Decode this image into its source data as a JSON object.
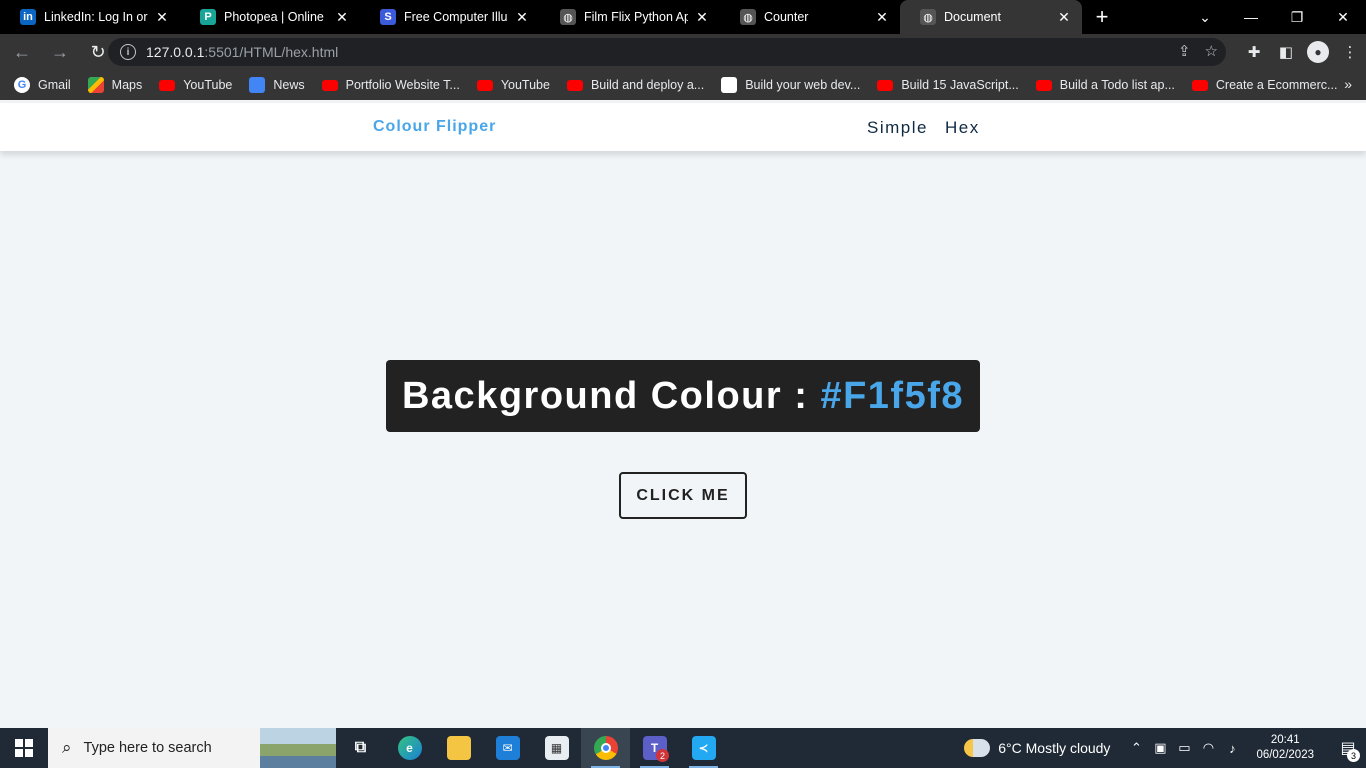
{
  "browser": {
    "tabs": [
      {
        "title": "LinkedIn: Log In or Sig",
        "icon": "linkedin-icon",
        "color": "#0a66c2",
        "glyph": "in"
      },
      {
        "title": "Photopea | Online Pho",
        "icon": "photopea-icon",
        "color": "#18a497",
        "glyph": "P"
      },
      {
        "title": "Free Computer Illustra",
        "icon": "storyset-icon",
        "color": "#3b5bdb",
        "glyph": "S"
      },
      {
        "title": "Film Flix Python App",
        "icon": "globe-icon",
        "color": "#555555",
        "glyph": "◍"
      },
      {
        "title": "Counter",
        "icon": "globe-icon",
        "color": "#555555",
        "glyph": "◍"
      },
      {
        "title": "Document",
        "icon": "globe-icon",
        "color": "#555555",
        "glyph": "◍",
        "active": true
      }
    ],
    "url_host": "127.0.0.1",
    "url_path": ":5501/HTML/hex.html",
    "bookmarks": [
      {
        "label": "Gmail",
        "type": "g"
      },
      {
        "label": "Maps",
        "type": "maps"
      },
      {
        "label": "YouTube",
        "type": "yt"
      },
      {
        "label": "News",
        "type": "news"
      },
      {
        "label": "Portfolio Website T...",
        "type": "yt"
      },
      {
        "label": "YouTube",
        "type": "yt"
      },
      {
        "label": "Build and deploy a...",
        "type": "yt"
      },
      {
        "label": "Build your web dev...",
        "type": "bars"
      },
      {
        "label": "Build 15 JavaScript...",
        "type": "yt"
      },
      {
        "label": "Build a Todo list ap...",
        "type": "yt"
      },
      {
        "label": "Create a Ecommerc...",
        "type": "yt"
      }
    ],
    "more_bookmarks": "»"
  },
  "page": {
    "brand": "Colour Flipper",
    "nav": [
      "Simple",
      "Hex"
    ],
    "colour_label": "Background Colour : ",
    "colour_value": "#F1f5f8",
    "button_label": "CLICK ME",
    "accent": "#49a6e9",
    "background": "#f1f5f8"
  },
  "taskbar": {
    "search_placeholder": "Type here to search",
    "weather": "6°C  Mostly cloudy",
    "time": "20:41",
    "date": "06/02/2023",
    "teams_badge": "2",
    "notification_count": "3"
  }
}
